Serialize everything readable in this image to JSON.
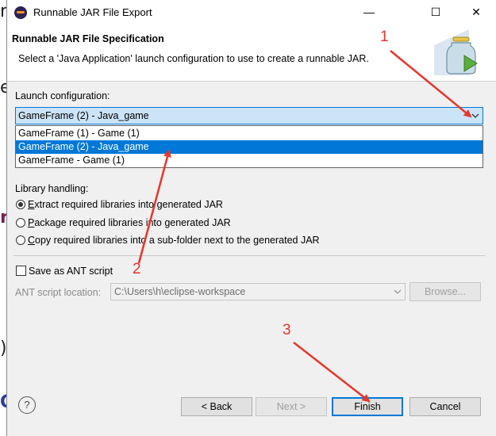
{
  "window": {
    "title": "Runnable JAR File Export",
    "controls": {
      "minimize": "—",
      "maximize": "☐",
      "close": "✕"
    }
  },
  "header": {
    "title": "Runnable JAR File Specification",
    "description": "Select a 'Java Application' launch configuration to use to create a runnable JAR."
  },
  "launch": {
    "label": "Launch configuration:",
    "selected": "GameFrame (2) - Java_game",
    "options": [
      "GameFrame (1) - Game (1)",
      "GameFrame (2) - Java_game",
      "GameFrame - Game (1)"
    ],
    "highlighted_index": 1
  },
  "library": {
    "label": "Library handling:",
    "options": [
      {
        "key": "E",
        "rest": "xtract required libraries into generated JAR",
        "selected": true
      },
      {
        "key": "P",
        "rest": "ackage required libraries into generated JAR",
        "selected": false
      },
      {
        "key": "C",
        "rest": "opy required libraries into a sub-folder next to the generated JAR",
        "selected": false
      }
    ]
  },
  "ant": {
    "checkbox_label": "Save as ANT script",
    "checked": false,
    "location_label": "ANT script location:",
    "location_value": "C:\\Users\\h\\eclipse-workspace",
    "browse_label": "Browse..."
  },
  "buttons": {
    "help": "?",
    "back": "< Back",
    "next": "Next >",
    "finish": "Finish",
    "cancel": "Cancel"
  },
  "annotations": [
    "1",
    "2",
    "3"
  ],
  "background_fragments": [
    "r",
    "e",
    "r",
    ")",
    "G"
  ],
  "colors": {
    "accent": "#0078d7",
    "annotation": "#e8352a"
  }
}
